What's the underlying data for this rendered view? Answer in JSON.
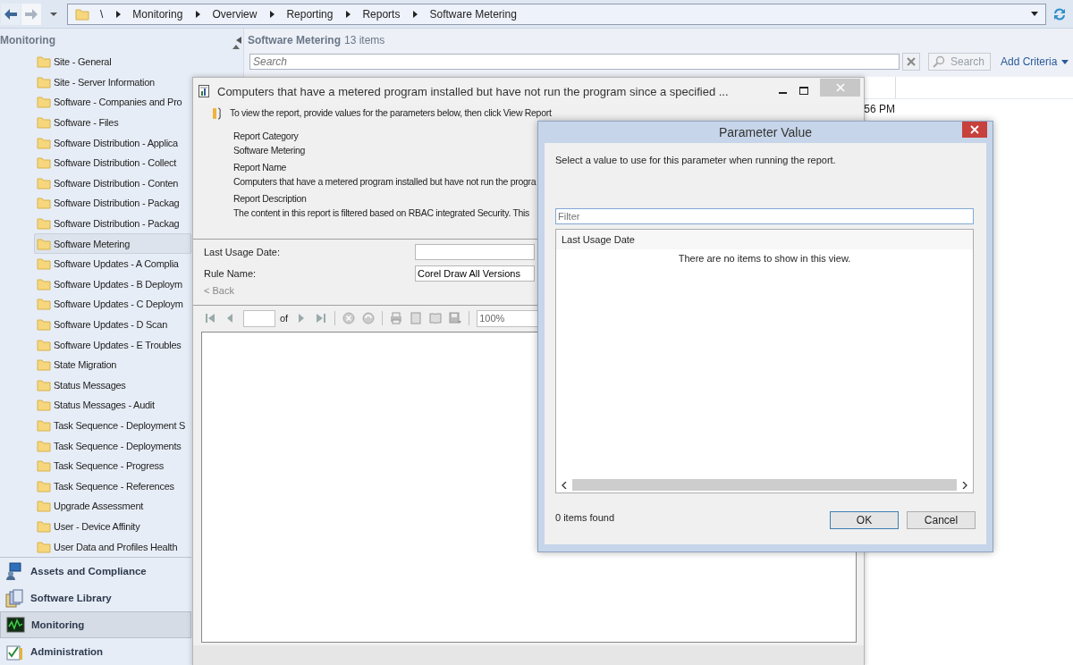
{
  "nav_buttons": [
    {
      "kind": "back",
      "disabled": false
    },
    {
      "kind": "forward",
      "disabled": true
    }
  ],
  "address_bar": {
    "breadcrumbs": [
      "\\",
      "Monitoring",
      "Overview",
      "Reporting",
      "Reports",
      "Software Metering"
    ]
  },
  "navigation_pane": {
    "title": "Monitoring",
    "items": [
      {
        "label": "Site - General",
        "selected": false
      },
      {
        "label": "Site - Server Information",
        "selected": false
      },
      {
        "label": "Software - Companies and Pro",
        "selected": false
      },
      {
        "label": "Software - Files",
        "selected": false
      },
      {
        "label": "Software Distribution - Applica",
        "selected": false
      },
      {
        "label": "Software Distribution - Collect",
        "selected": false
      },
      {
        "label": "Software Distribution - Conten",
        "selected": false
      },
      {
        "label": "Software Distribution - Packag",
        "selected": false
      },
      {
        "label": "Software Distribution - Packag",
        "selected": false
      },
      {
        "label": "Software Metering",
        "selected": true
      },
      {
        "label": "Software Updates - A Complia",
        "selected": false
      },
      {
        "label": "Software Updates - B Deploym",
        "selected": false
      },
      {
        "label": "Software Updates - C Deploym",
        "selected": false
      },
      {
        "label": "Software Updates - D Scan",
        "selected": false
      },
      {
        "label": "Software Updates - E Troubles",
        "selected": false
      },
      {
        "label": "State Migration",
        "selected": false
      },
      {
        "label": "Status Messages",
        "selected": false
      },
      {
        "label": "Status Messages - Audit",
        "selected": false
      },
      {
        "label": "Task Sequence - Deployment S",
        "selected": false
      },
      {
        "label": "Task Sequence - Deployments",
        "selected": false
      },
      {
        "label": "Task Sequence - Progress",
        "selected": false
      },
      {
        "label": "Task Sequence - References",
        "selected": false
      },
      {
        "label": "Upgrade Assessment",
        "selected": false
      },
      {
        "label": "User - Device Affinity",
        "selected": false
      },
      {
        "label": "User Data and Profiles Health",
        "selected": false
      }
    ]
  },
  "workspaces": [
    {
      "label": "Assets and Compliance",
      "kind": "assets",
      "selected": false
    },
    {
      "label": "Software Library",
      "kind": "library",
      "selected": false
    },
    {
      "label": "Monitoring",
      "kind": "monitoring",
      "selected": true
    },
    {
      "label": "Administration",
      "kind": "administration",
      "selected": false
    }
  ],
  "content_pane": {
    "title": "Software Metering",
    "count": "13 items",
    "search": {
      "placeholder": "Search"
    },
    "search_button": "Search",
    "add_criteria": "Add Criteria",
    "rows": [
      {
        "column_1": "56 PM"
      }
    ]
  },
  "report_window": {
    "title": "Computers that have a metered program installed but have not run the program since a specified ...",
    "instruction": "To view the report, provide values for the parameters below, then click View Report",
    "details": [
      {
        "kind": "label",
        "text": "Report Category"
      },
      {
        "kind": "value",
        "text": "Software Metering"
      },
      {
        "kind": "label",
        "text": "Report Name"
      },
      {
        "kind": "value",
        "text": "Computers that have a metered program installed but have not run the progra"
      },
      {
        "kind": "label",
        "text": "Report Description"
      },
      {
        "kind": "value",
        "text": "The content in this report is filtered based on RBAC integrated Security. This"
      }
    ],
    "parameters": [
      {
        "label": "Last Usage Date:"
      },
      {
        "label": "Rule Name:",
        "value": "Corel Draw All Versions"
      }
    ],
    "back_link": "< Back",
    "viewer_toolbar": {
      "of_label": "of",
      "zoom": "100%"
    }
  },
  "parameter_dialog": {
    "title": "Parameter Value",
    "prompt": "Select a value to use for this parameter when running the report.",
    "filter": {
      "placeholder": "Filter"
    },
    "list": {
      "columns": [
        "Last Usage Date"
      ],
      "empty_message": "There are no items to show in this view."
    },
    "status": "0 items found",
    "buttons": [
      {
        "label": "OK",
        "default": true
      },
      {
        "label": "Cancel",
        "default": false
      }
    ]
  }
}
